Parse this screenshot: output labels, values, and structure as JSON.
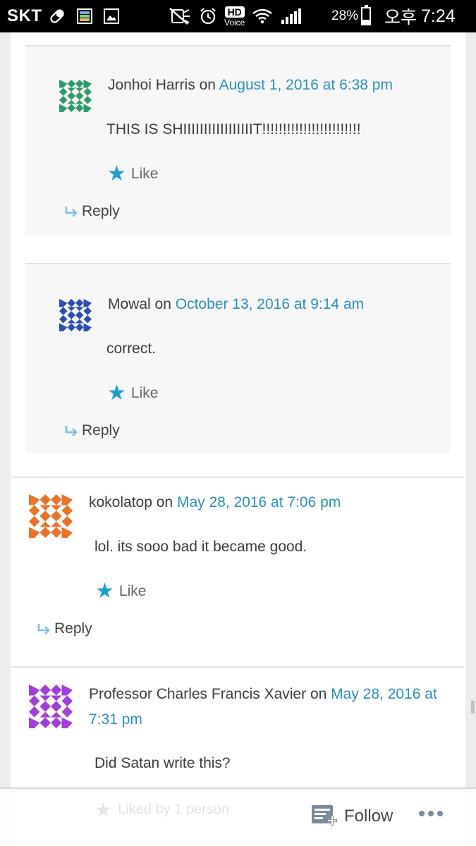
{
  "status_bar": {
    "carrier": "SKT",
    "hd_label": "HD",
    "voice_label": "Voice",
    "battery": "28%",
    "ampm": "오후",
    "time": "7:24"
  },
  "comments": [
    {
      "author": "Jonhoi Harris",
      "on_word": "on",
      "date": "August 1, 2016 at 6:38 pm",
      "text": "THIS IS SHIIIIIIIIIIIIIIIIIT!!!!!!!!!!!!!!!!!!!!!!!!",
      "like_label": "Like",
      "reply_label": "Reply",
      "avatar_color": "#2e9b6a",
      "nested": true
    },
    {
      "author": "Mowal",
      "on_word": "on",
      "date": "October 13, 2016 at 9:14 am",
      "text": "correct.",
      "like_label": "Like",
      "reply_label": "Reply",
      "avatar_color": "#2a4fb0",
      "nested": true
    },
    {
      "author": "kokolatop",
      "on_word": "on",
      "date": "May 28, 2016 at 7:06 pm",
      "text": "lol. its sooo bad it became good.",
      "like_label": "Like",
      "reply_label": "Reply",
      "avatar_color": "#e8742a",
      "nested": false
    },
    {
      "author": "Professor Charles Francis Xavier",
      "on_word": "on",
      "date": "May 28, 2016 at 7:31 pm",
      "text": "Did Satan write this?",
      "avatar_color": "#a23ed8",
      "nested": false
    }
  ],
  "bottom_bar": {
    "faded_text": "Liked by 1 person",
    "follow_label": "Follow"
  },
  "colors": {
    "link": "#2a8fbf",
    "star": "#1e9fd0",
    "reply_arrow": "#7fbfe0"
  }
}
